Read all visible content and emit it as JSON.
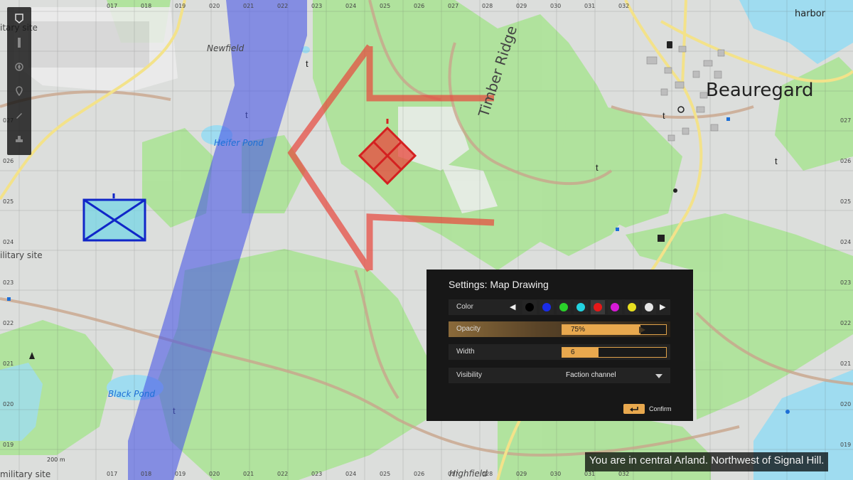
{
  "map": {
    "towns": [
      {
        "name": "Beauregard"
      },
      {
        "name": "harbor"
      },
      {
        "name": "Newfield"
      },
      {
        "name": "Timber Ridge"
      },
      {
        "name": "Highfield"
      },
      {
        "name": "itary site"
      },
      {
        "name": "ilitary site"
      },
      {
        "name": "military site"
      }
    ],
    "water": [
      {
        "name": "Heifer Pond"
      },
      {
        "name": "Black Pond"
      }
    ],
    "grid_x": [
      "017",
      "018",
      "019",
      "020",
      "021",
      "022",
      "023",
      "024",
      "025",
      "026",
      "027",
      "028",
      "029",
      "030",
      "031",
      "032"
    ],
    "grid_y": [
      "027",
      "026",
      "025",
      "024",
      "023",
      "022",
      "021",
      "020",
      "019"
    ],
    "scale_label": "200 m",
    "colors": {
      "drawing_red": "#e8473c",
      "corridor_blue": "#4a57e6",
      "unit_blue": "#1026c8",
      "unit_fill": "#6fd6e6"
    }
  },
  "toolbar": {
    "tools": [
      {
        "icon": "map-icon"
      },
      {
        "icon": "ruler-icon"
      },
      {
        "icon": "compass-icon"
      },
      {
        "icon": "marker-icon"
      },
      {
        "icon": "pen-icon"
      },
      {
        "icon": "stamp-icon"
      }
    ]
  },
  "settings": {
    "title": "Settings: Map Drawing",
    "color": {
      "label": "Color",
      "swatches": [
        "#000000",
        "#1a2ce8",
        "#2ad12a",
        "#22d3e0",
        "#e61818",
        "#d61ad6",
        "#e8e020",
        "#e6e6e6"
      ],
      "selected_index": 4
    },
    "opacity": {
      "label": "Opacity",
      "value_text": "75%",
      "value": 0.75
    },
    "width": {
      "label": "Width",
      "value_text": "6",
      "value": 0.35
    },
    "visibility": {
      "label": "Visibility",
      "value": "Faction channel"
    },
    "confirm": {
      "label": "Confirm",
      "key_icon": "enter-key-icon"
    }
  },
  "status": {
    "text": "You are in central Arland. Northwest of Signal Hill."
  }
}
